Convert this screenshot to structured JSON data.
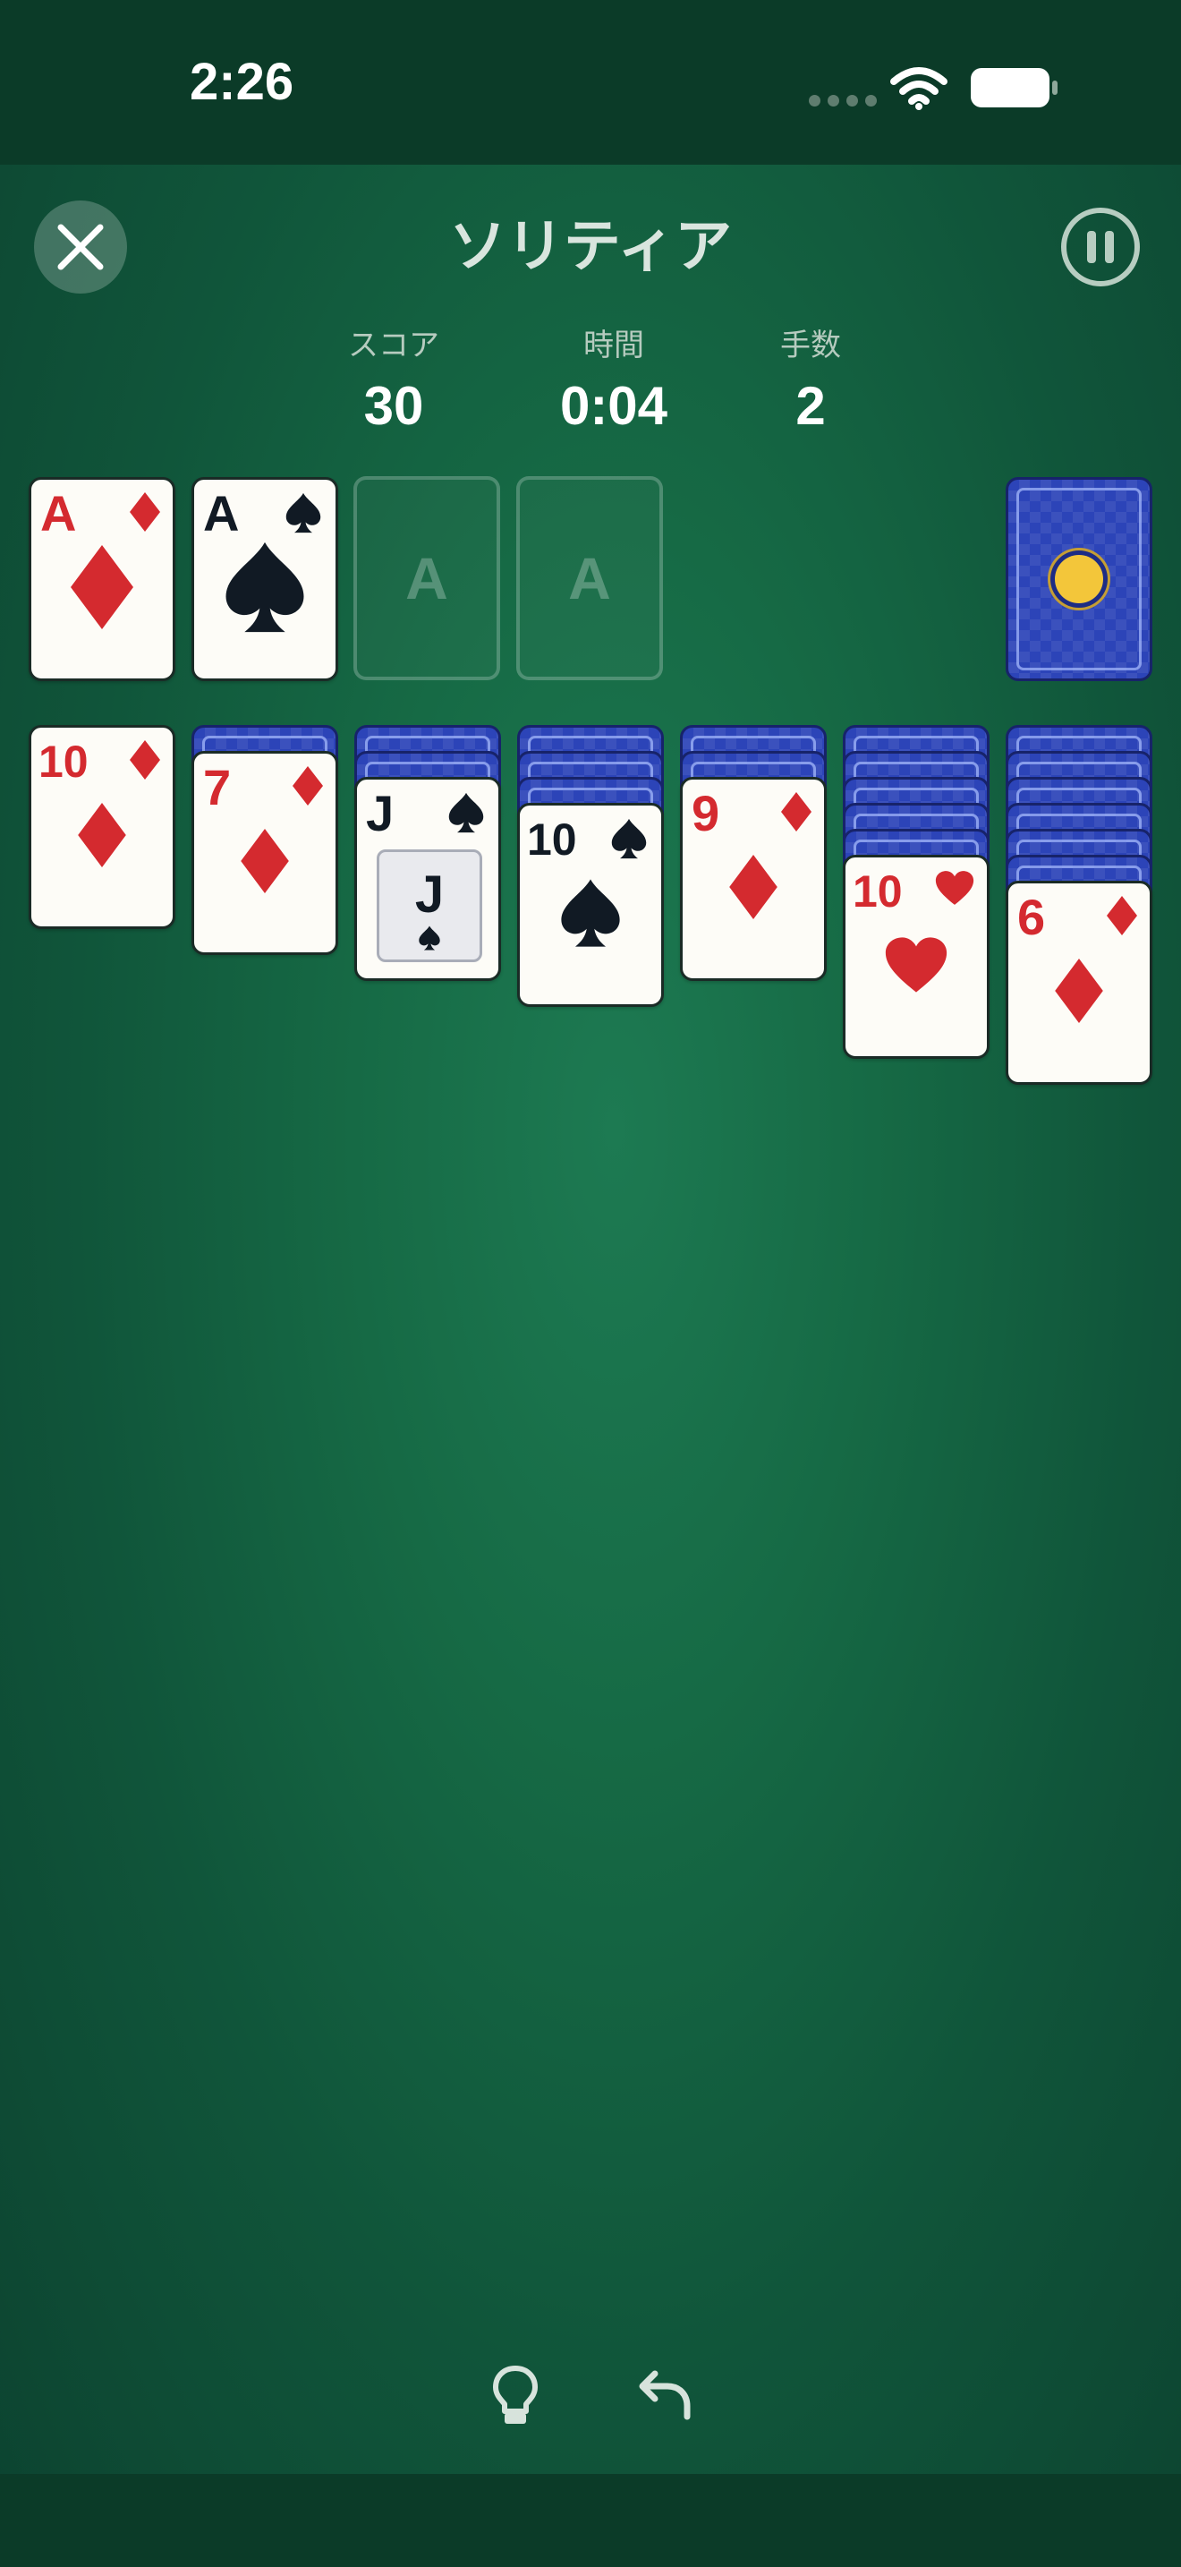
{
  "status_bar": {
    "time": "2:26"
  },
  "header": {
    "title": "ソリティア"
  },
  "stats": [
    {
      "label": "スコア",
      "value": "30"
    },
    {
      "label": "時間",
      "value": "0:04"
    },
    {
      "label": "手数",
      "value": "2"
    }
  ],
  "foundations": [
    {
      "rank": "A",
      "suit": "diamond"
    },
    {
      "rank": "A",
      "suit": "spade"
    },
    {
      "placeholder": "A"
    },
    {
      "placeholder": "A"
    }
  ],
  "stock": {
    "face_down": true
  },
  "tableau": [
    {
      "face_down": 0,
      "top": {
        "rank": "10",
        "suit": "diamond"
      }
    },
    {
      "face_down": 1,
      "top": {
        "rank": "7",
        "suit": "diamond"
      }
    },
    {
      "face_down": 2,
      "top": {
        "rank": "J",
        "suit": "spade",
        "face_card": true
      }
    },
    {
      "face_down": 3,
      "top": {
        "rank": "10",
        "suit": "spade"
      }
    },
    {
      "face_down": 2,
      "top": {
        "rank": "9",
        "suit": "diamond"
      }
    },
    {
      "face_down": 5,
      "top": {
        "rank": "10",
        "suit": "heart"
      }
    },
    {
      "face_down": 6,
      "top": {
        "rank": "6",
        "suit": "diamond"
      }
    }
  ],
  "toolbar": {
    "hint_icon": "lightbulb-icon",
    "undo_icon": "undo-arrow-icon"
  },
  "colors": {
    "felt": "#166a45",
    "red_suit": "#d42a2f",
    "black_suit": "#111a24",
    "card_back": "#2c44b8"
  }
}
